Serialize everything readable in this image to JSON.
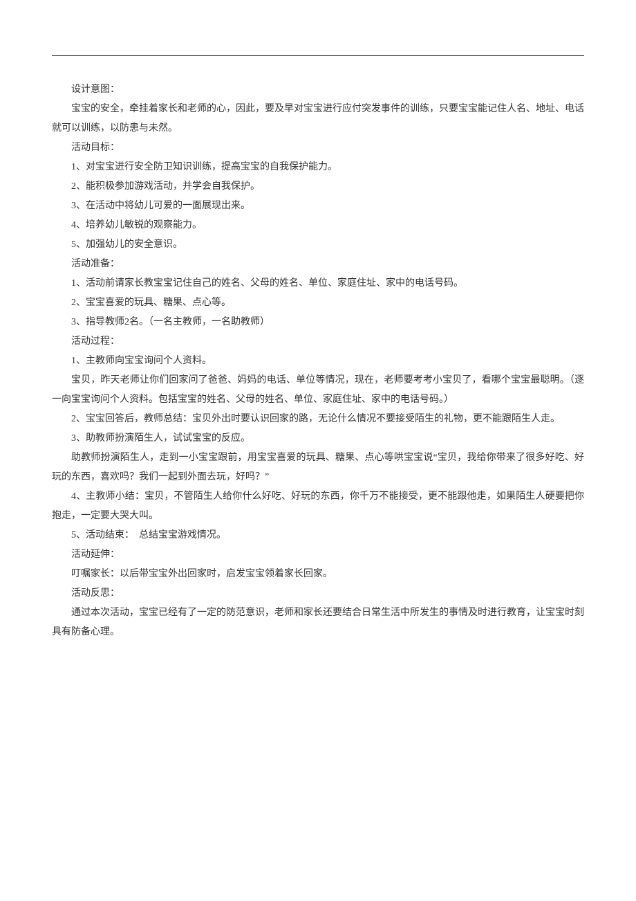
{
  "paragraphs": [
    "设计意图：",
    "宝宝的安全，牵挂着家长和老师的心，因此，要及早对宝宝进行应付突发事件的训练，只要宝宝能记住人名、地址、电话就可以训练，以防患与未然。",
    "活动目标：",
    "1、对宝宝进行安全防卫知识训练，提高宝宝的自我保护能力。",
    "2、能积极参加游戏活动，并学会自我保护。",
    "3、在活动中将幼儿可爱的一面展现出来。",
    "4、培养幼儿敏锐的观察能力。",
    "5、加强幼儿的安全意识。",
    "活动准备：",
    "1、活动前请家长教宝宝记住自己的姓名、父母的姓名、单位、家庭住址、家中的电话号码。",
    "2、宝宝喜爱的玩具、糖果、点心等。",
    "3、指导教师2名。（一名主教师，一名助教师）",
    "活动过程：",
    "1、主教师向宝宝询问个人资料。",
    "宝贝，昨天老师让你们回家问了爸爸、妈妈的电话、单位等情况，现在，老师要考考小宝贝了，看哪个宝宝最聪明。（逐一向宝宝询问个人资料。包括宝宝的姓名、父母的姓名、单位、家庭住址、家中的电话号码。）",
    "2、宝宝回答后，教师总结：宝贝外出时要认识回家的路，无论什么情况不要接受陌生的礼物，更不能跟陌生人走。",
    "3、助教师扮演陌生人，试试宝宝的反应。",
    "助教师扮演陌生人，走到一小宝宝跟前，用宝宝喜爱的玩具、糖果、点心等哄宝宝说“宝贝，我给你带来了很多好吃、好玩的东西，喜欢吗？我们一起到外面去玩，好吗？”",
    "4、主教师小结：宝贝，不管陌生人给你什么好吃、好玩的东西，你千万不能接受，更不能跟他走，如果陌生人硬要把你抱走，一定要大哭大叫。",
    "5、活动结束：　总结宝宝游戏情况。",
    "活动延伸：",
    "叮嘱家长：以后带宝宝外出回家时，启发宝宝领着家长回家。",
    "活动反思：",
    "通过本次活动，宝宝已经有了一定的防范意识，老师和家长还要结合日常生活中所发生的事情及时进行教育，让宝宝时刻具有防备心理。"
  ]
}
